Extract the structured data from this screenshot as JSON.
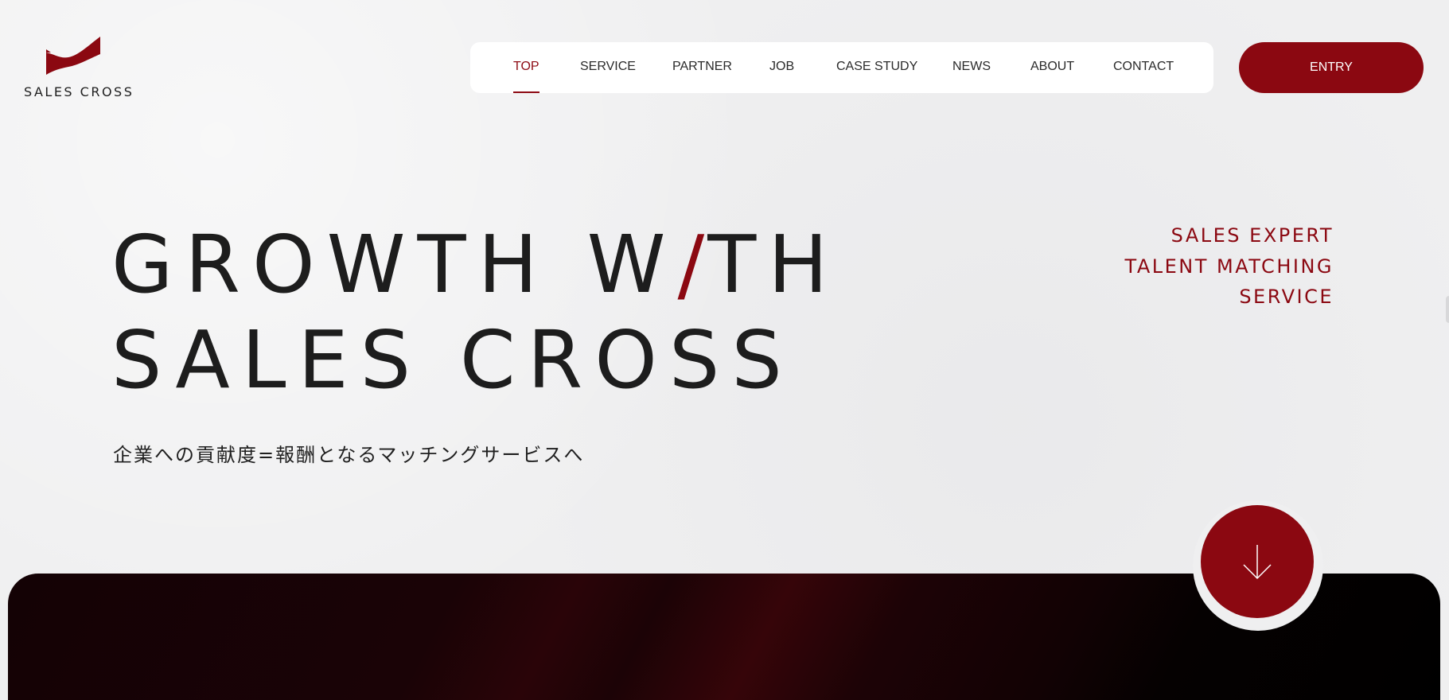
{
  "brand": {
    "logo_text": "SALES CROSS",
    "logo_icon": "flag-logo-icon",
    "accent_color": "#8b0811"
  },
  "nav": {
    "items": [
      {
        "label": "TOP",
        "active": true
      },
      {
        "label": "SERVICE",
        "active": false
      },
      {
        "label": "PARTNER",
        "active": false
      },
      {
        "label": "JOB",
        "active": false
      },
      {
        "label": "CASE STUDY",
        "active": false
      },
      {
        "label": "NEWS",
        "active": false
      },
      {
        "label": "ABOUT",
        "active": false
      },
      {
        "label": "CONTACT",
        "active": false
      }
    ],
    "entry_label": "ENTRY"
  },
  "hero": {
    "line1_before": "GROWTH W",
    "line1_slash": "/",
    "line1_after": "TH",
    "line2": "SALES CROSS",
    "subtitle": "企業への貢献度=報酬となるマッチングサービスへ",
    "tagline": [
      "SALES EXPERT",
      "TALENT MATCHING",
      "SERVICE"
    ]
  },
  "scroll": {
    "icon": "arrow-down-icon"
  }
}
